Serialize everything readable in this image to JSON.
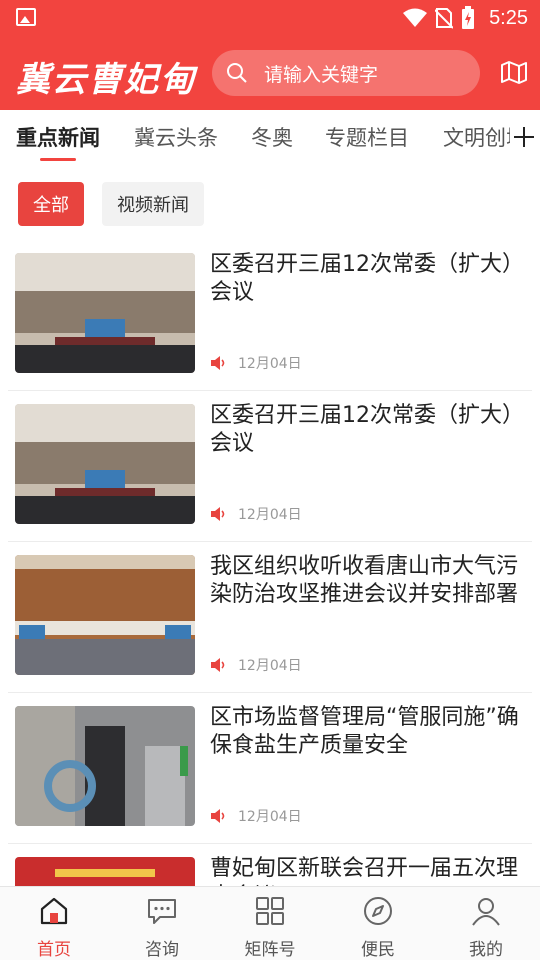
{
  "status_bar": {
    "time": "5:25"
  },
  "header": {
    "logo_text": "冀云曹妃甸",
    "search_placeholder": "请输入关键字"
  },
  "channels": [
    {
      "label": "重点新闻",
      "active": true
    },
    {
      "label": "冀云头条",
      "active": false
    },
    {
      "label": "冬奥",
      "active": false
    },
    {
      "label": "专题栏目",
      "active": false
    },
    {
      "label": "文明创城",
      "active": false
    }
  ],
  "filters": [
    {
      "label": "全部",
      "active": true
    },
    {
      "label": "视频新闻",
      "active": false
    }
  ],
  "news": [
    {
      "title": "区委召开三届12次常委（扩大）会议",
      "date": "12月04日",
      "thumb": "meeting-hall"
    },
    {
      "title": "区委召开三届12次常委（扩大）会议",
      "date": "12月04日",
      "thumb": "meeting-hall"
    },
    {
      "title": "我区组织收听收看唐山市大气污染防治攻坚推进会议并安排部署",
      "date": "12月04日",
      "thumb": "video-conference"
    },
    {
      "title": "区市场监督管理局“管服同施”确保食盐生产质量安全",
      "date": "12月04日",
      "thumb": "factory-inspection"
    },
    {
      "title": "曹妃甸区新联会召开一届五次理事会议",
      "date": "",
      "thumb": "banner-meeting"
    }
  ],
  "bottom_nav": [
    {
      "label": "首页",
      "icon": "home-icon",
      "active": true
    },
    {
      "label": "咨询",
      "icon": "chat-icon",
      "active": false
    },
    {
      "label": "矩阵号",
      "icon": "grid-icon",
      "active": false
    },
    {
      "label": "便民",
      "icon": "compass-icon",
      "active": false
    },
    {
      "label": "我的",
      "icon": "user-icon",
      "active": false
    }
  ],
  "colors": {
    "brand_red": "#f2443f",
    "active_red": "#e8443f"
  }
}
